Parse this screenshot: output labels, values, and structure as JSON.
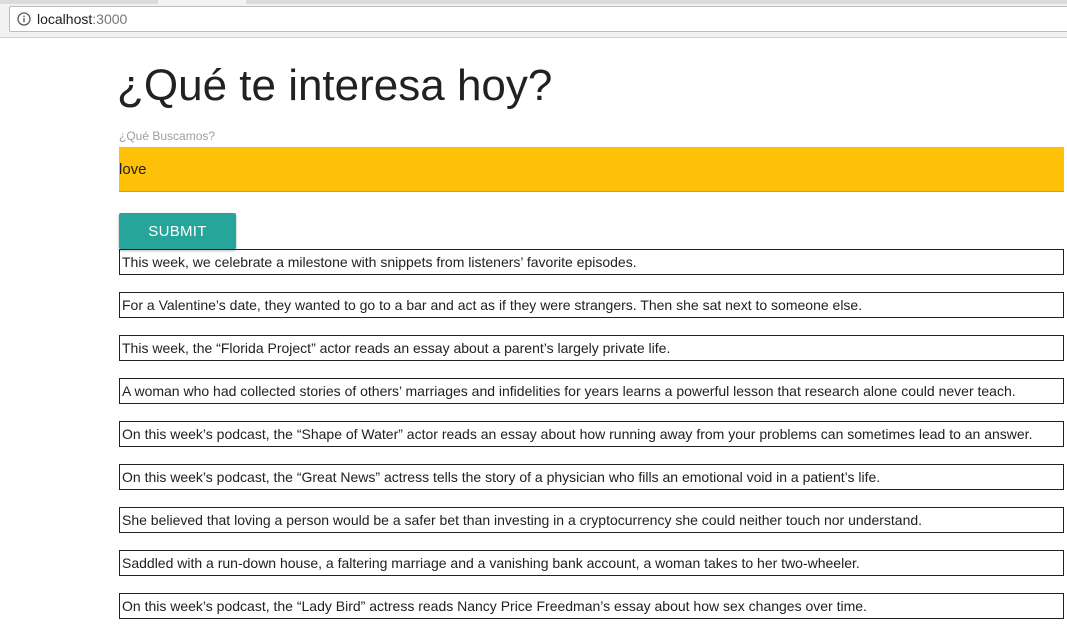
{
  "browser": {
    "url_host": "localhost",
    "url_port": ":3000"
  },
  "page": {
    "title": "¿Qué te interesa hoy?",
    "search_label": "¿Qué Buscamos?",
    "search_value": "love",
    "submit_label": "SUBMIT"
  },
  "results": [
    "This week, we celebrate a milestone with snippets from listeners’ favorite episodes.",
    "For a Valentine’s date, they wanted to go to a bar and act as if they were strangers. Then she sat next to someone else.",
    "This week, the “Florida Project” actor reads an essay about a parent’s largely private life.",
    "A woman who had collected stories of others’ marriages and infidelities for years learns a powerful lesson that research alone could never teach.",
    "On this week’s podcast, the “Shape of Water” actor reads an essay about how running away from your problems can sometimes lead to an answer.",
    "On this week’s podcast, the “Great News” actress tells the story of a physician who fills an emotional void in a patient’s life.",
    "She believed that loving a person would be a safer bet than investing in a cryptocurrency she could neither touch nor understand.",
    "Saddled with a run-down house, a faltering marriage and a vanishing bank account, a woman takes to her two-wheeler.",
    "On this week’s podcast, the “Lady Bird” actress reads Nancy Price Freedman’s essay about how sex changes over time."
  ],
  "colors": {
    "input_background": "#ffc107",
    "submit_background": "#26a69a"
  }
}
